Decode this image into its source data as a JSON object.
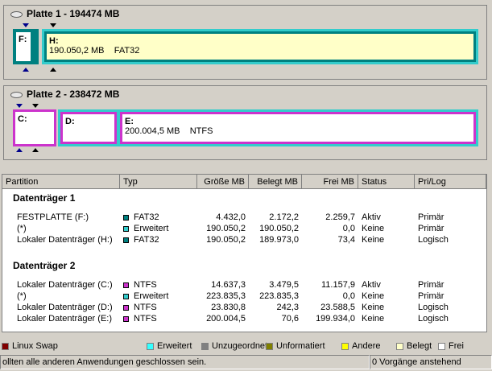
{
  "disks": [
    {
      "title": "Platte 1 - 194474 MB",
      "partitions": [
        {
          "letter": "F:",
          "size_text": "",
          "fs": ""
        },
        {
          "letter": "H:",
          "size_text": "190.050,2 MB",
          "fs": "FAT32"
        }
      ]
    },
    {
      "title": "Platte 2 - 238472 MB",
      "partitions": [
        {
          "letter": "C:",
          "size_text": "",
          "fs": ""
        },
        {
          "letter": "D:",
          "size_text": "",
          "fs": ""
        },
        {
          "letter": "E:",
          "size_text": "200.004,5 MB",
          "fs": "NTFS"
        }
      ]
    }
  ],
  "table": {
    "headers": [
      "Partition",
      "Typ",
      "Größe MB",
      "Belegt MB",
      "Frei MB",
      "Status",
      "Pri/Log"
    ],
    "groups": [
      {
        "title": "Datenträger 1",
        "rows": [
          {
            "partition": "FESTPLATTE (F:)",
            "typ": "FAT32",
            "color": "#008080",
            "size": "4.432,0",
            "used": "2.172,2",
            "free": "2.259,7",
            "status": "Aktiv",
            "prilog": "Primär"
          },
          {
            "partition": "(*)",
            "typ": "Erweitert",
            "color": "#33cccc",
            "size": "190.050,2",
            "used": "190.050,2",
            "free": "0,0",
            "status": "Keine",
            "prilog": "Primär"
          },
          {
            "partition": "Lokaler Datenträger (H:)",
            "typ": "FAT32",
            "color": "#008080",
            "size": "190.050,2",
            "used": "189.973,0",
            "free": "73,4",
            "status": "Keine",
            "prilog": "Logisch"
          }
        ]
      },
      {
        "title": "Datenträger 2",
        "rows": [
          {
            "partition": "Lokaler Datenträger (C:)",
            "typ": "NTFS",
            "color": "#cc33cc",
            "size": "14.637,3",
            "used": "3.479,5",
            "free": "11.157,9",
            "status": "Aktiv",
            "prilog": "Primär"
          },
          {
            "partition": "(*)",
            "typ": "Erweitert",
            "color": "#33cccc",
            "size": "223.835,3",
            "used": "223.835,3",
            "free": "0,0",
            "status": "Keine",
            "prilog": "Primär"
          },
          {
            "partition": "Lokaler Datenträger (D:)",
            "typ": "NTFS",
            "color": "#cc33cc",
            "size": "23.830,8",
            "used": "242,3",
            "free": "23.588,5",
            "status": "Keine",
            "prilog": "Logisch"
          },
          {
            "partition": "Lokaler Datenträger (E:)",
            "typ": "NTFS",
            "color": "#cc33cc",
            "size": "200.004,5",
            "used": "70,6",
            "free": "199.934,0",
            "status": "Keine",
            "prilog": "Logisch"
          }
        ]
      }
    ]
  },
  "legend": [
    {
      "label": "Linux Swap",
      "color": "#800000"
    },
    {
      "label": "Erweitert",
      "color": "#33ffff"
    },
    {
      "label": "Unzugeordnet",
      "color": "#808080"
    },
    {
      "label": "Unformatiert",
      "color": "#808000"
    },
    {
      "label": "Andere",
      "color": "#ffff00"
    },
    {
      "label": "Belegt",
      "color": "#ffffc8"
    },
    {
      "label": "Frei",
      "color": "#ffffff"
    }
  ],
  "status": {
    "message": "ollten alle anderen Anwendungen geschlossen sein.",
    "pending": "0 Vorgänge anstehend"
  },
  "colors": {
    "fat32_border": "#008080",
    "extended_border": "#33cccc",
    "ntfs_border": "#cc33cc"
  }
}
